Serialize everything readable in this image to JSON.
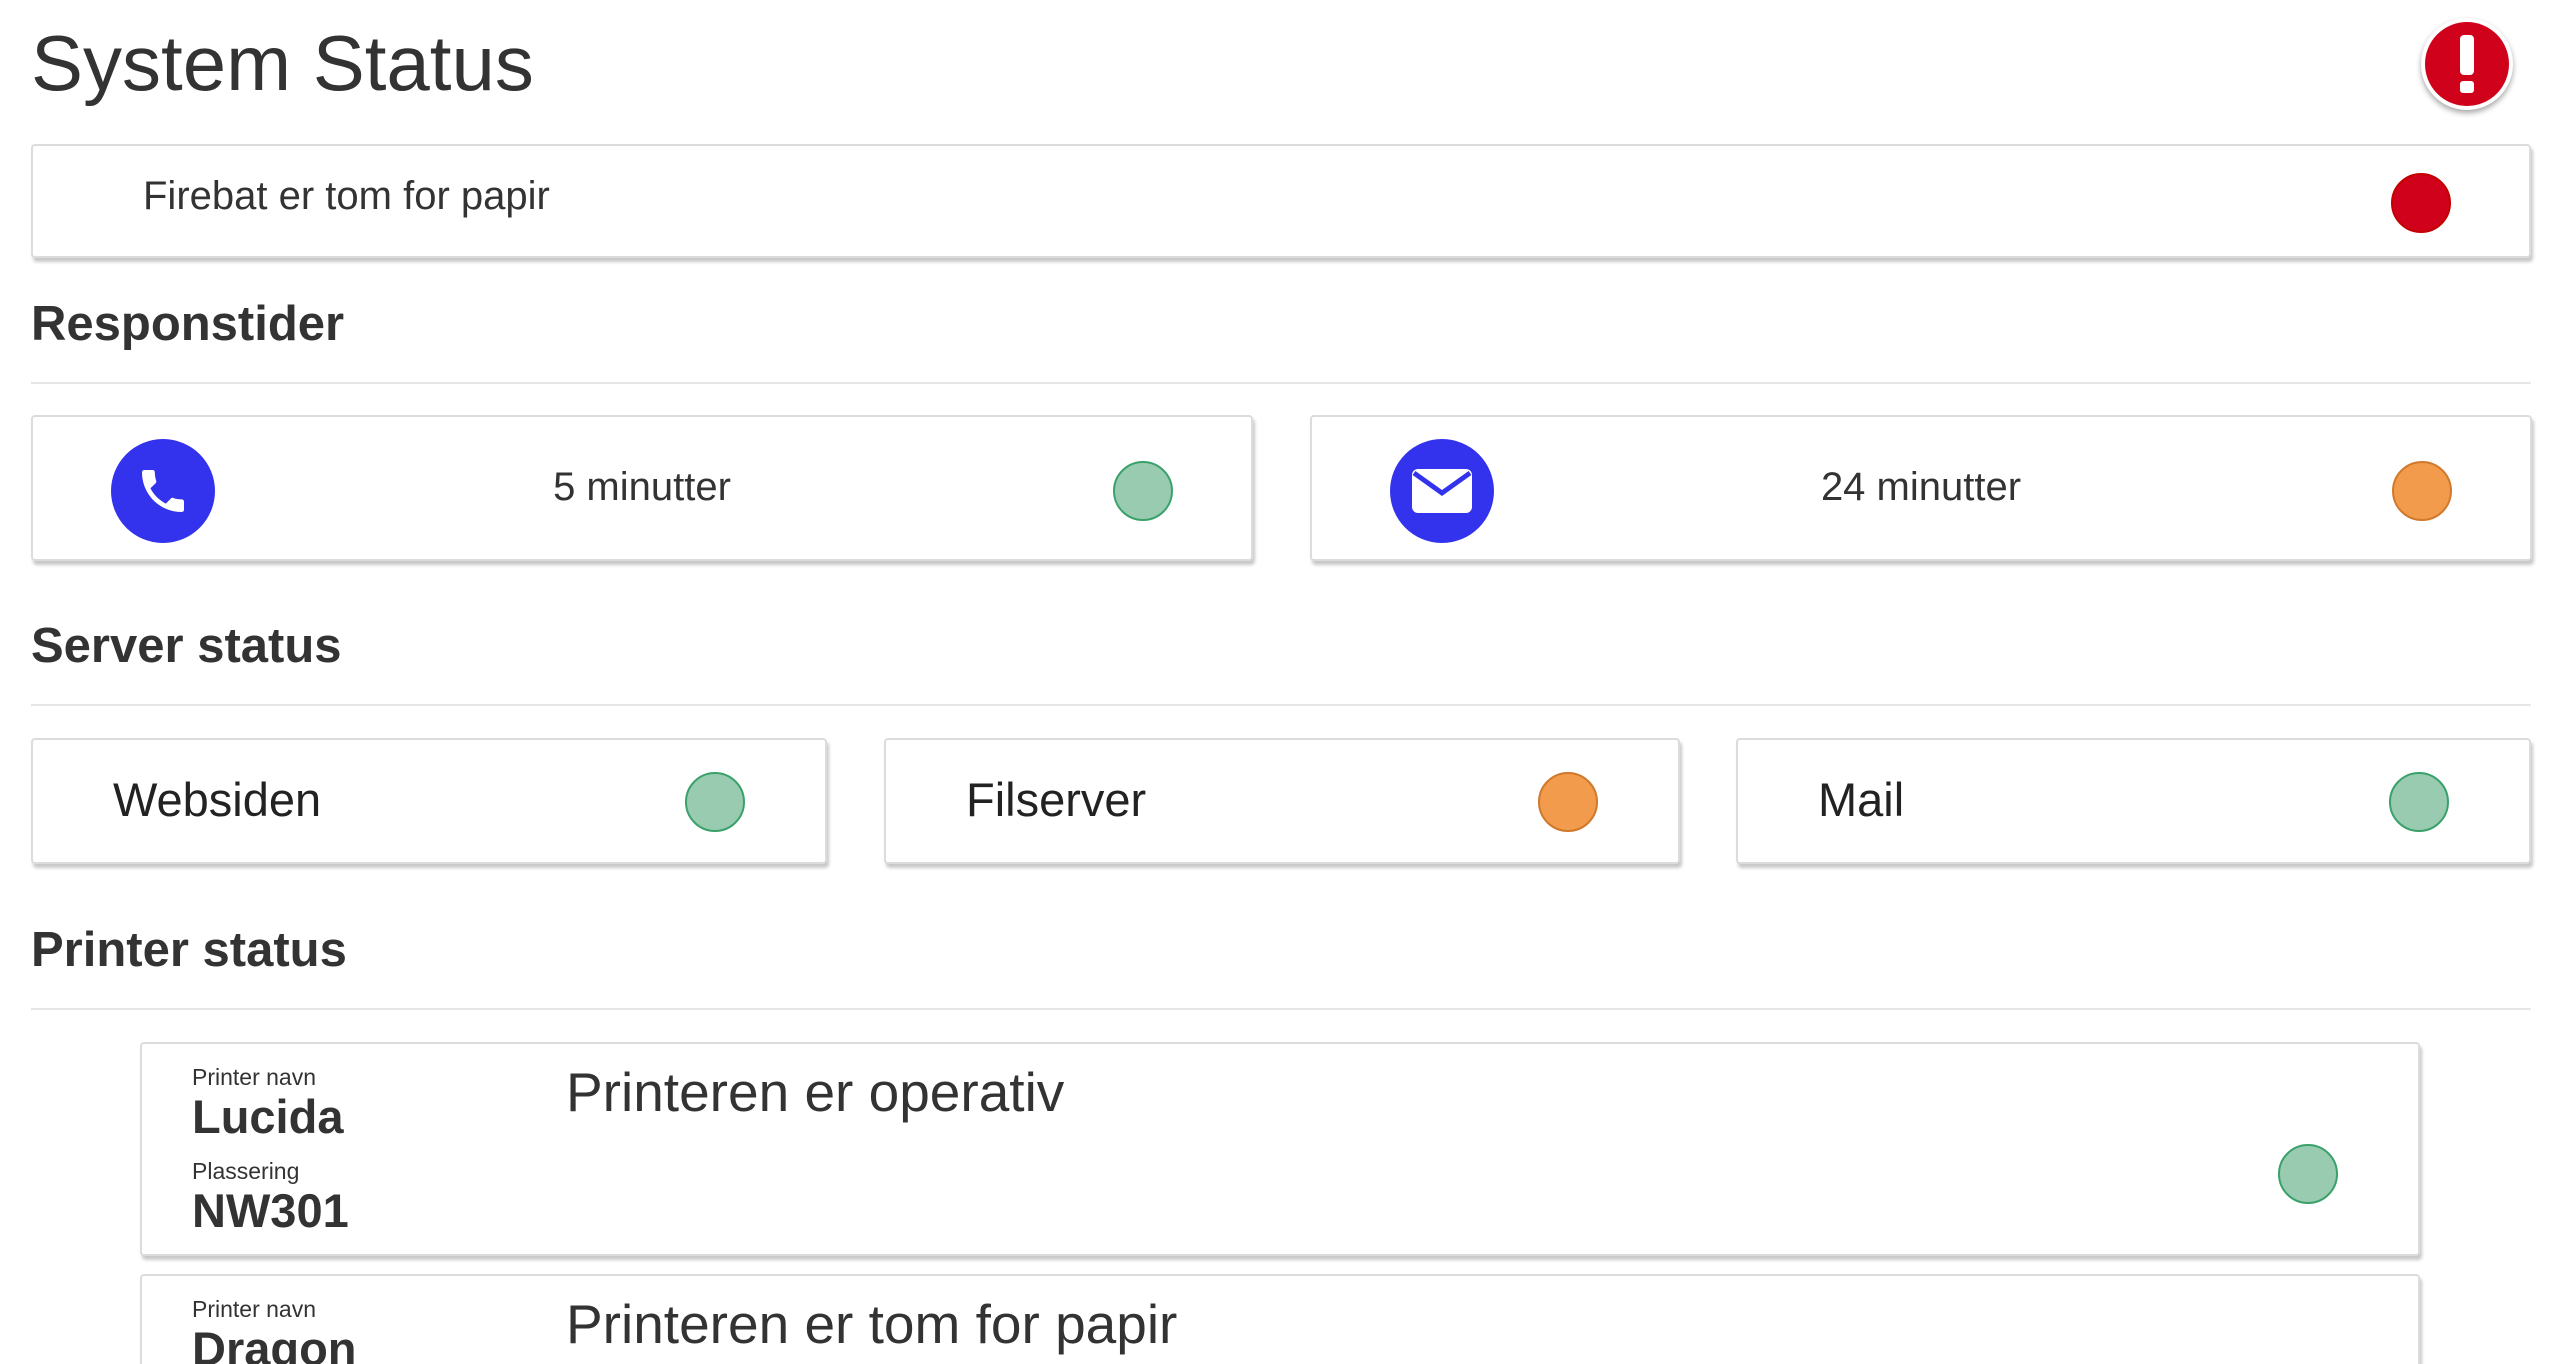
{
  "header": {
    "title": "System Status",
    "alert_icon": "exclamation-icon"
  },
  "alert": {
    "message": "Firebat er tom for papir",
    "status_color": "#d0021b"
  },
  "response_times": {
    "title": "Responstider",
    "items": [
      {
        "icon": "phone-icon",
        "value": "5 minutter",
        "status": "green"
      },
      {
        "icon": "envelope-icon",
        "value": "24 minutter",
        "status": "orange"
      }
    ]
  },
  "servers": {
    "title": "Server status",
    "items": [
      {
        "name": "Websiden",
        "status": "green"
      },
      {
        "name": "Filserver",
        "status": "orange"
      },
      {
        "name": "Mail",
        "status": "green"
      }
    ]
  },
  "printers": {
    "title": "Printer status",
    "name_label": "Printer navn",
    "location_label": "Plassering",
    "items": [
      {
        "name": "Lucida",
        "location": "NW301",
        "status_text": "Printeren er operativ",
        "status": "green"
      },
      {
        "name": "Dragon",
        "status_text": "Printeren er tom for papir"
      }
    ]
  },
  "colors": {
    "green": "#98cbb0",
    "orange": "#f29b4c",
    "red": "#d0021b",
    "icon_blue": "#3333ee"
  }
}
